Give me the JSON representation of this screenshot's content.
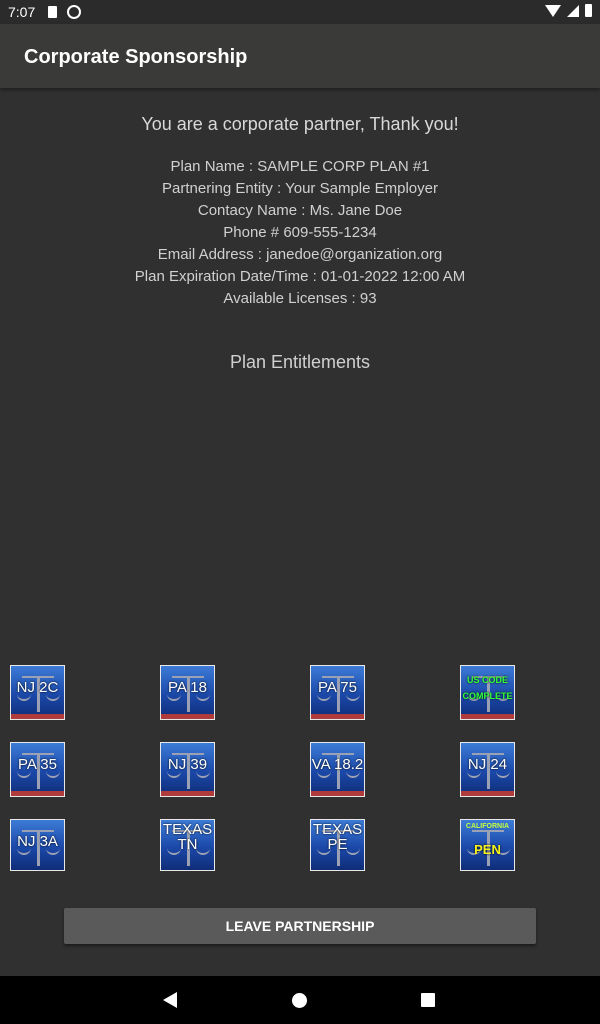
{
  "status_bar": {
    "time": "7:07"
  },
  "app_bar": {
    "title": "Corporate Sponsorship"
  },
  "partner": {
    "thanks": "You are a corporate partner, Thank you!",
    "details": [
      "Plan Name : SAMPLE CORP PLAN #1",
      "Partnering Entity : Your Sample Employer",
      "Contacy Name : Ms. Jane Doe",
      "Phone # 609-555-1234",
      "Email Address : janedoe@organization.org",
      "Plan Expiration Date/Time : 01-01-2022 12:00 AM",
      "Available Licenses : 93"
    ]
  },
  "entitlements": {
    "title": "Plan Entitlements",
    "tiles": [
      {
        "label": "NJ 2C"
      },
      {
        "label": "PA 18"
      },
      {
        "label": "PA 75"
      },
      {
        "label": "US CODE\nCOMPLETE"
      },
      {
        "label": "PA 35"
      },
      {
        "label": "NJ 39"
      },
      {
        "label": "VA 18.2"
      },
      {
        "label": "NJ 24"
      },
      {
        "label": "NJ 3A"
      },
      {
        "label": "TEXAS\nTN"
      },
      {
        "label": "TEXAS\nPE"
      },
      {
        "top": "CALIFORNIA",
        "label": "PEN"
      }
    ]
  },
  "actions": {
    "leave_label": "LEAVE PARTNERSHIP"
  },
  "icons": {
    "status": [
      "sd-card-icon",
      "sync-icon",
      "wifi-icon",
      "cell-signal-icon",
      "battery-icon"
    ],
    "nav": [
      "back-icon",
      "home-icon",
      "recents-icon"
    ]
  }
}
